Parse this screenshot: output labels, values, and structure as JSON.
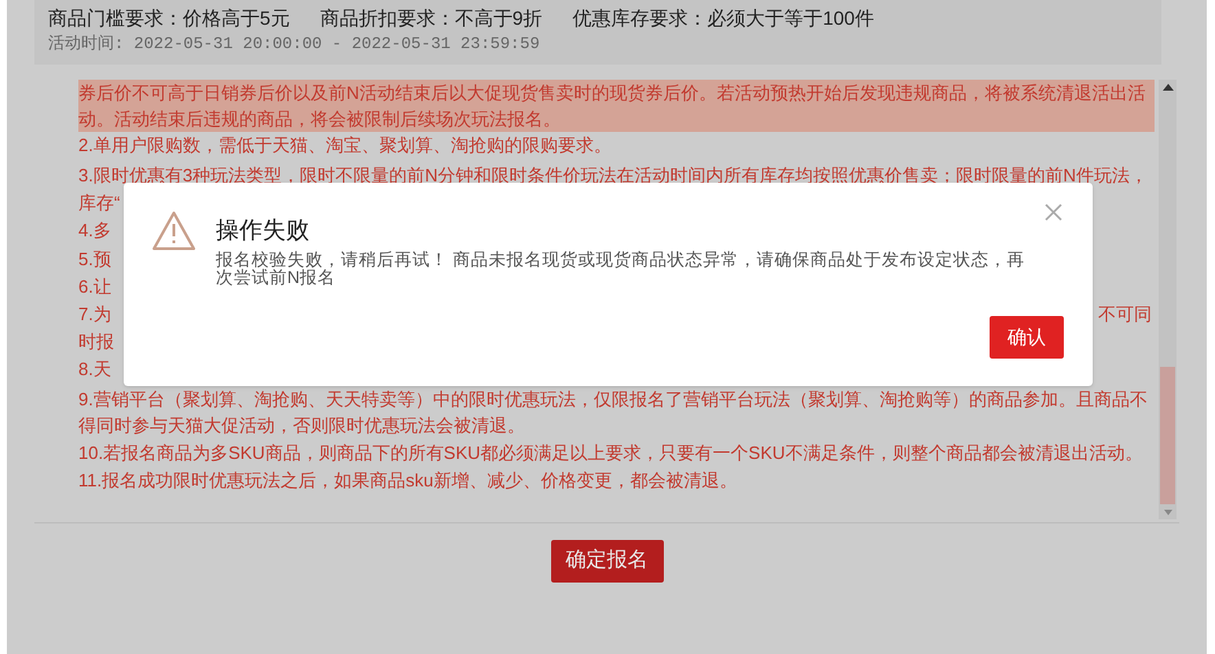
{
  "header": {
    "requirements": [
      "商品门槛要求：价格高于5元",
      "商品折扣要求：不高于9折",
      "优惠库存要求：必须大于等于100件"
    ],
    "time": "活动时间: 2022-05-31 20:00:00 - 2022-05-31 23:59:59"
  },
  "rules": [
    {
      "text": "券后价不可高于日销券后价以及前N活动结束后以大促现货售卖时的现货券后价。若活动预热开始后发现违规商品，将被系统清退活出活动。活动结束后违规的商品，将会被限制后续场次玩法报名。",
      "highlighted": true
    },
    {
      "text": "2.单用户限购数，需低于天猫、淘宝、聚划算、淘抢购的限购要求。",
      "highlighted": false
    },
    {
      "text": "3.限时优惠有3种玩法类型，限时不限量的前N分钟和限时条件价玩法在活动时间内所有库存均按照优惠价售卖；限时限量的前N件玩法，",
      "highlighted": false
    },
    {
      "text": "库存“",
      "highlighted": false
    },
    {
      "text": "4.多",
      "highlighted": false
    },
    {
      "text": "5.预",
      "highlighted": false
    },
    {
      "text": "6.让",
      "highlighted": false
    },
    {
      "text": "7.为",
      "right": "不可同",
      "highlighted": false
    },
    {
      "text": "时报",
      "highlighted": false
    },
    {
      "text": "8.天",
      "highlighted": false
    },
    {
      "text": "9.营销平台（聚划算、淘抢购、天天特卖等）中的限时优惠玩法，仅限报名了营销平台玩法（聚划算、淘抢购等）的商品参加。且商品不得同时参与天猫大促活动，否则限时优惠玩法会被清退。",
      "highlighted": false
    },
    {
      "text": "10.若报名商品为多SKU商品，则商品下的所有SKU都必须满足以上要求，只要有一个SKU不满足条件，则整个商品都会被清退出活动。",
      "highlighted": false
    },
    {
      "text": "11.报名成功限时优惠玩法之后，如果商品sku新增、减少、价格变更，都会被清退。",
      "highlighted": false
    }
  ],
  "submit_button": "确定报名",
  "dialog": {
    "title": "操作失败",
    "message": "报名校验失败，请稍后再试！ 商品未报名现货或现货商品状态异常，请确保商品处于发布设定状态，再次尝试前N报名",
    "confirm": "确认"
  }
}
